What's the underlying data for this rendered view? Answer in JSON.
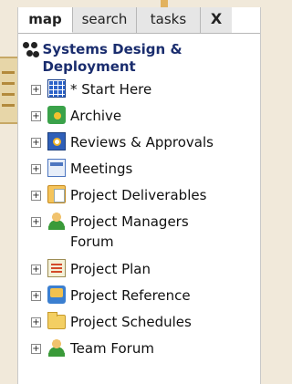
{
  "tabs": [
    {
      "label": "map",
      "active": true
    },
    {
      "label": "search",
      "active": false
    },
    {
      "label": "tasks",
      "active": false
    }
  ],
  "close_label": "X",
  "root": {
    "label": "Systems Design & Deployment",
    "icon": "network-icon"
  },
  "items": [
    {
      "label": "* Start Here",
      "icon": "grid-icon"
    },
    {
      "label": "Archive",
      "icon": "archive-icon"
    },
    {
      "label": "Reviews & Approvals",
      "icon": "calendar-check-icon"
    },
    {
      "label": "Meetings",
      "icon": "calendar-icon"
    },
    {
      "label": "Project Deliverables",
      "icon": "documents-icon"
    },
    {
      "label": "Project Managers Forum",
      "icon": "person-icon"
    },
    {
      "label": "Project Plan",
      "icon": "plan-icon"
    },
    {
      "label": "Project Reference",
      "icon": "reference-icon"
    },
    {
      "label": "Project Schedules",
      "icon": "folder-icon"
    },
    {
      "label": "Team Forum",
      "icon": "person-icon"
    }
  ],
  "expander_symbol": "+"
}
